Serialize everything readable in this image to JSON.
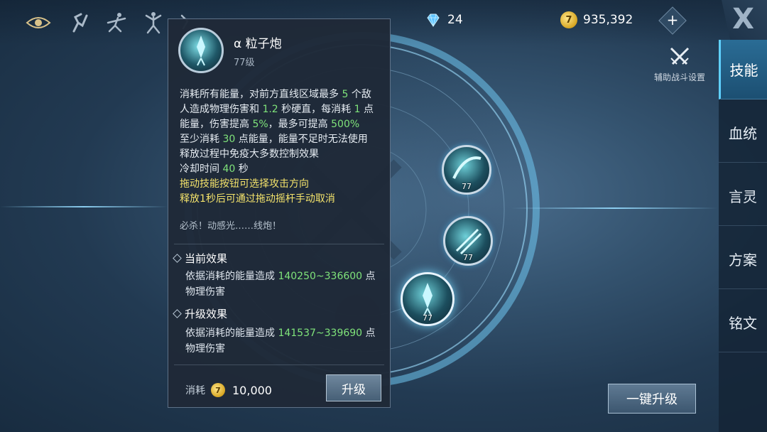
{
  "topbar": {
    "icons": [
      "eye-icon",
      "runner-icon",
      "dancer-icon",
      "ballet-icon",
      "figure-icon"
    ],
    "gems": "24",
    "coins": "935,392",
    "coin_symbol": "7",
    "plus": "+",
    "close": "X"
  },
  "assist": {
    "label": "辅助战斗设置"
  },
  "tabs": [
    {
      "label": "技能",
      "active": true
    },
    {
      "label": "血统",
      "active": false
    },
    {
      "label": "言灵",
      "active": false
    },
    {
      "label": "方案",
      "active": false
    },
    {
      "label": "铭文",
      "active": false
    }
  ],
  "skills": [
    {
      "level": "77"
    },
    {
      "level": "77"
    },
    {
      "level": "77"
    }
  ],
  "upgrade_all": "一键升级",
  "panel": {
    "name": "α 粒子炮",
    "level": "77级",
    "desc": {
      "l1a": "消耗所有能量，对前方直线区域最多 ",
      "l1n": "5",
      "l1b": " 个敌",
      "l2a": "人造成物理伤害和 ",
      "l2n": "1.2",
      "l2b": " 秒硬直，每消耗 ",
      "l2n2": "1",
      "l2c": " 点",
      "l3a": "能量，伤害提高 ",
      "l3n": "5%",
      "l3b": "，最多可提高 ",
      "l3n2": "500%",
      "l4a": "至少消耗 ",
      "l4n": "30",
      "l4b": " 点能量，能量不足时无法使用",
      "l5": "释放过程中免疫大多数控制效果",
      "l6a": "冷却时间 ",
      "l6n": "40",
      "l6b": " 秒",
      "l7": "拖动技能按钮可选择攻击方向",
      "l8": "释放1秒后可通过拖动摇杆手动取消"
    },
    "flavor": "必杀！动感光……线炮！",
    "current": {
      "title": "当前效果",
      "pre": "依据消耗的能量造成 ",
      "range": "140250~336600",
      "post": " 点",
      "line2": "物理伤害"
    },
    "upgrade": {
      "title": "升级效果",
      "pre": "依据消耗的能量造成 ",
      "range": "141537~339690",
      "post": " 点",
      "line2": "物理伤害"
    },
    "cost_label": "消耗",
    "cost_value": "10,000",
    "upgrade_button": "升级"
  }
}
